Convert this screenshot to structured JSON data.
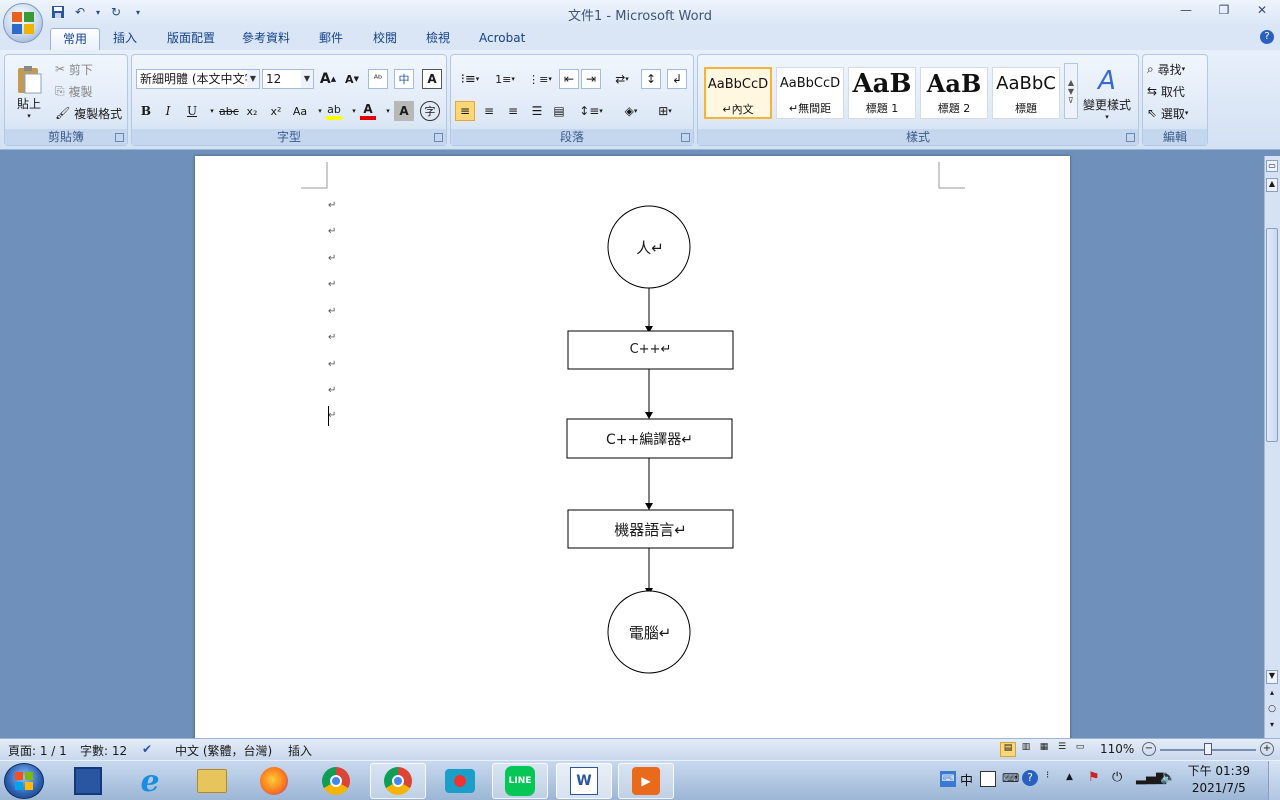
{
  "window": {
    "title": "文件1 - Microsoft Word"
  },
  "qat": {
    "save": "save-icon",
    "undo": "↶",
    "undo_arrow": "▾",
    "redo": "↻",
    "customize": "▾"
  },
  "tabs": [
    "常用",
    "插入",
    "版面配置",
    "參考資料",
    "郵件",
    "校閱",
    "檢視",
    "Acrobat"
  ],
  "clipboard": {
    "paste": "貼上",
    "cut": "剪下",
    "copy": "複製",
    "format_painter": "複製格式",
    "group": "剪貼簿"
  },
  "font": {
    "name": "新細明體 (本文中文字",
    "size": "12",
    "bold": "B",
    "italic": "I",
    "underline": "U",
    "strike": "abc",
    "sub": "x₂",
    "sup": "x²",
    "case": "Aa",
    "grow": "A",
    "shrink": "A",
    "group": "字型"
  },
  "paragraph": {
    "group": "段落"
  },
  "styles": {
    "items": [
      {
        "sample": "AaBbCcD",
        "name": "↵內文"
      },
      {
        "sample": "AaBbCcD",
        "name": "↵無間距"
      },
      {
        "sample": "AaB",
        "name": "標題 1"
      },
      {
        "sample": "AaB",
        "name": "標題 2"
      },
      {
        "sample": "AaBbC",
        "name": "標題"
      }
    ],
    "change": "變更樣式",
    "group": "樣式"
  },
  "editing": {
    "find": "尋找",
    "replace": "取代",
    "select": "選取",
    "group": "編輯"
  },
  "flowchart": {
    "n1": "人↵",
    "n2": "C++↵",
    "n3": "C++編譯器↵",
    "n4": "機器語言↵",
    "n5": "電腦↵"
  },
  "para_mark": "↵",
  "status": {
    "page": "頁面: 1 / 1",
    "words": "字數: 12",
    "lang": "中文 (繁體，台灣)",
    "mode": "插入",
    "zoom": "110%"
  },
  "taskbar": {
    "clock_time": "下午 01:39",
    "clock_date": "2021/7/5",
    "ime": "中"
  },
  "colors": {
    "accent": "#15428b",
    "highlight": "#ffff00",
    "font_red": "#e00000"
  }
}
